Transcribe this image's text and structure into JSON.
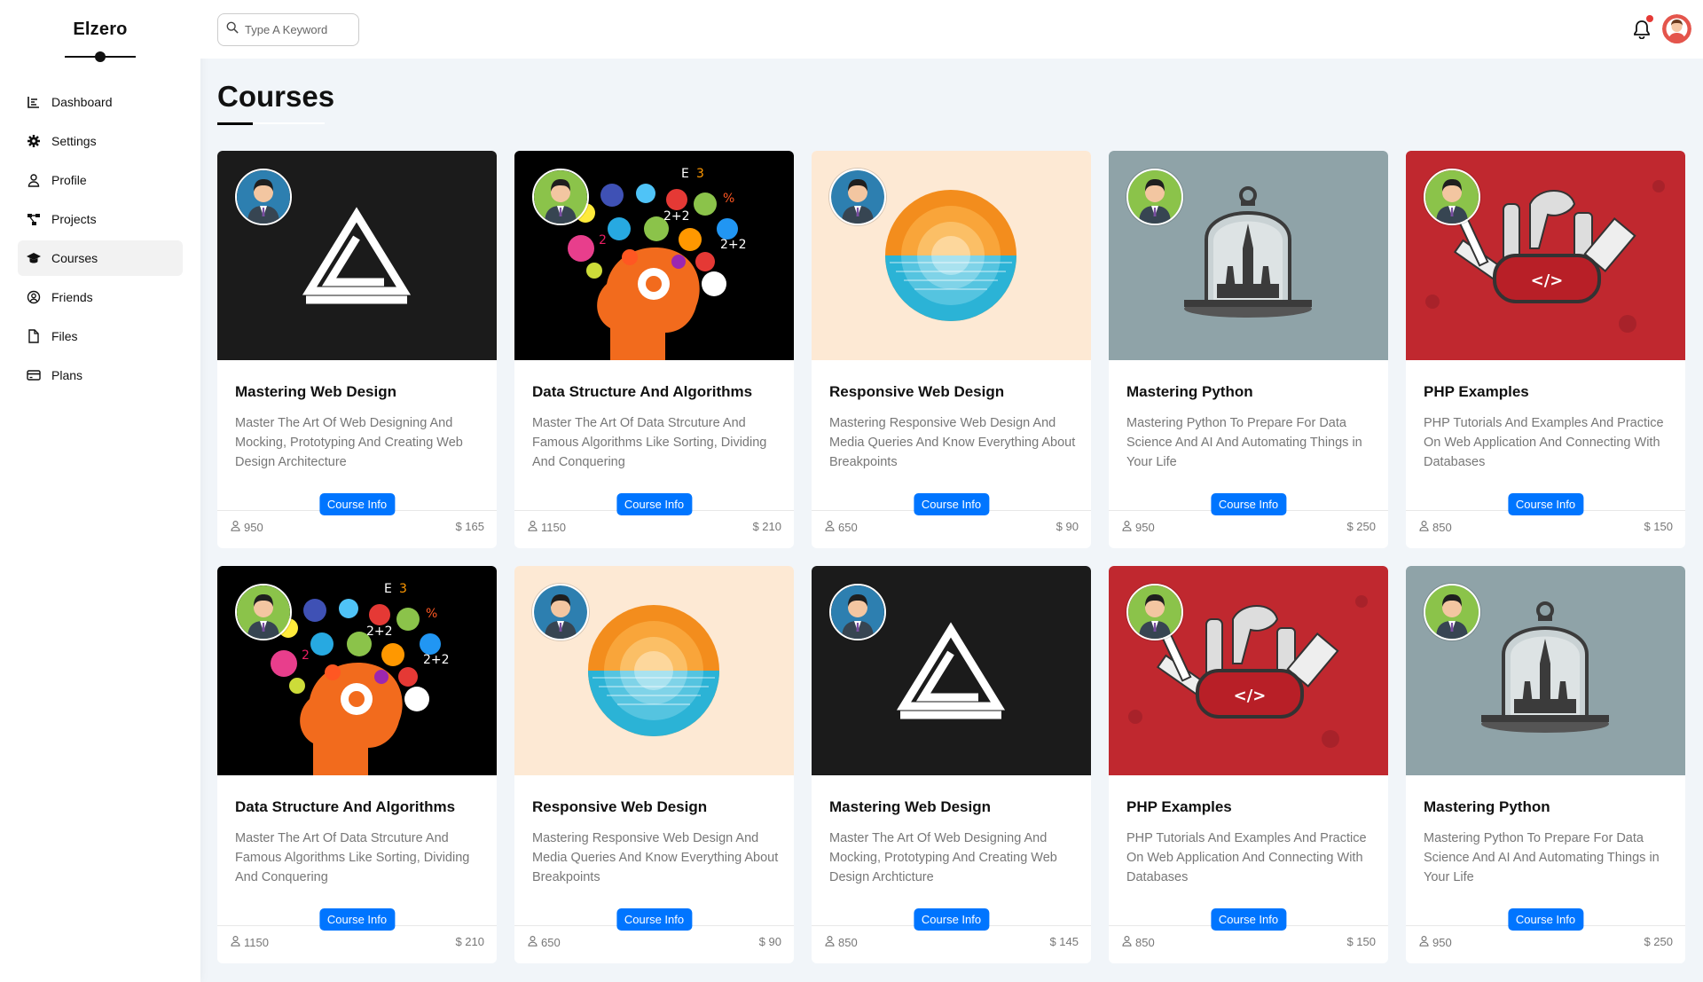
{
  "brand": "Elzero",
  "sidebar": {
    "items": [
      {
        "label": "Dashboard"
      },
      {
        "label": "Settings"
      },
      {
        "label": "Profile"
      },
      {
        "label": "Projects"
      },
      {
        "label": "Courses",
        "active": true
      },
      {
        "label": "Friends"
      },
      {
        "label": "Files"
      },
      {
        "label": "Plans"
      }
    ]
  },
  "header": {
    "search_placeholder": "Type A Keyword",
    "icons": [
      "search-icon",
      "bell-icon",
      "avatar"
    ]
  },
  "main": {
    "title": "Courses",
    "button_label": "Course Info",
    "currency": "$",
    "courses": [
      {
        "title": "Mastering Web Design",
        "desc": "Master The Art Of Web Designing And Mocking, Prototyping And Creating Web Design Architecture",
        "students": "950",
        "price": "165",
        "art": "web"
      },
      {
        "title": "Data Structure And Algorithms",
        "desc": "Master The Art Of Data Strcuture And Famous Algorithms Like Sorting, Dividing And Conquering",
        "students": "1150",
        "price": "210",
        "art": "data"
      },
      {
        "title": "Responsive Web Design",
        "desc": "Mastering Responsive Web Design And Media Queries And Know Everything About Breakpoints",
        "students": "650",
        "price": "90",
        "art": "responsive"
      },
      {
        "title": "Mastering Python",
        "desc": "Mastering Python To Prepare For Data Science And AI And Automating Things in Your Life",
        "students": "950",
        "price": "250",
        "art": "python"
      },
      {
        "title": "PHP Examples",
        "desc": "PHP Tutorials And Examples And Practice On Web Application And Connecting With Databases",
        "students": "850",
        "price": "150",
        "art": "php"
      },
      {
        "title": "Data Structure And Algorithms",
        "desc": "Master The Art Of Data Strcuture And Famous Algorithms Like Sorting, Dividing And Conquering",
        "students": "1150",
        "price": "210",
        "art": "data"
      },
      {
        "title": "Responsive Web Design",
        "desc": "Mastering Responsive Web Design And Media Queries And Know Everything About Breakpoints",
        "students": "650",
        "price": "90",
        "art": "responsive"
      },
      {
        "title": "Mastering Web Design",
        "desc": "Master The Art Of Web Designing And Mocking, Prototyping And Creating Web Design Archticture",
        "students": "850",
        "price": "145",
        "art": "web"
      },
      {
        "title": "PHP Examples",
        "desc": "PHP Tutorials And Examples And Practice On Web Application And Connecting With Databases",
        "students": "850",
        "price": "150",
        "art": "php"
      },
      {
        "title": "Mastering Python",
        "desc": "Mastering Python To Prepare For Data Science And AI And Automating Things in Your Life",
        "students": "950",
        "price": "250",
        "art": "python"
      }
    ]
  },
  "colors": {
    "accent": "#0075ff",
    "web_bg": "#1b1b1b",
    "data_bg": "#000000",
    "responsive_bg": "#fde9d4",
    "python_bg": "#8fa3a8",
    "php_bg": "#c0282f"
  }
}
